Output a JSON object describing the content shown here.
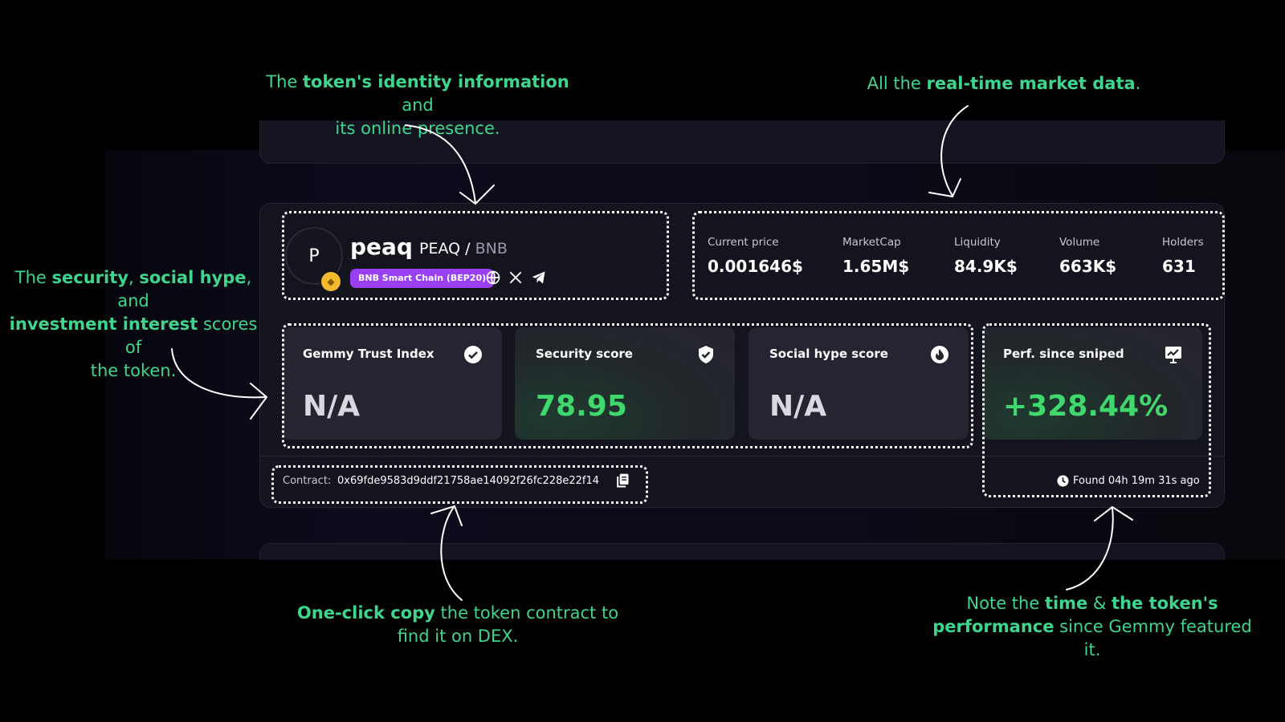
{
  "annotations": {
    "identity": {
      "pre": "The ",
      "bold1": "token's identity information",
      "mid": " and",
      "line2": "its online presence."
    },
    "market": {
      "pre": "All the ",
      "bold1": "real-time market data",
      "post": "."
    },
    "scores": {
      "pre": "The ",
      "bold1": "security",
      "sep1": ", ",
      "bold2": "social hype",
      "sep2": ", and",
      "bold3": "investment interest",
      "mid": " scores of",
      "line3": "the token."
    },
    "copy": {
      "bold1": "One-click copy",
      "post": " the token contract to",
      "line2": "find it on DEX."
    },
    "perf": {
      "pre": "Note the ",
      "bold1": "time",
      "mid": " & ",
      "bold2": "the token's",
      "bold3": "performance",
      "post": " since Gemmy featured it."
    }
  },
  "token": {
    "avatar_letter": "P",
    "name": "peaq",
    "base": "PEAQ",
    "separator": "/",
    "quote": "BNB",
    "chain": "BNB Smart Chain (BEP20)",
    "socials": [
      "globe-icon",
      "x-icon",
      "telegram-icon"
    ]
  },
  "market": {
    "items": [
      {
        "label": "Current price",
        "value": "0.001646$"
      },
      {
        "label": "MarketCap",
        "value": "1.65M$"
      },
      {
        "label": "Liquidity",
        "value": "84.9K$"
      },
      {
        "label": "Volume",
        "value": "663K$"
      },
      {
        "label": "Holders",
        "value": "631"
      }
    ]
  },
  "scores": [
    {
      "label": "Gemmy Trust Index",
      "value": "N/A",
      "icon": "check-badge-icon"
    },
    {
      "label": "Security score",
      "value": "78.95",
      "icon": "shield-check-icon"
    },
    {
      "label": "Social hype score",
      "value": "N/A",
      "icon": "flame-icon"
    },
    {
      "label": "Perf. since sniped",
      "value": "+328.44%",
      "icon": "chart-board-icon"
    }
  ],
  "contract": {
    "label": "Contract:",
    "address": "0x69fde9583d9ddf21758ae14092f26fc228e22f14"
  },
  "found": {
    "text": "Found 04h 19m 31s ago"
  },
  "colors": {
    "accent_green": "#3dd68c",
    "positive": "#3fd86c",
    "chain_badge": "#9b3ff5",
    "background": "#000000",
    "card": "#14141f"
  }
}
